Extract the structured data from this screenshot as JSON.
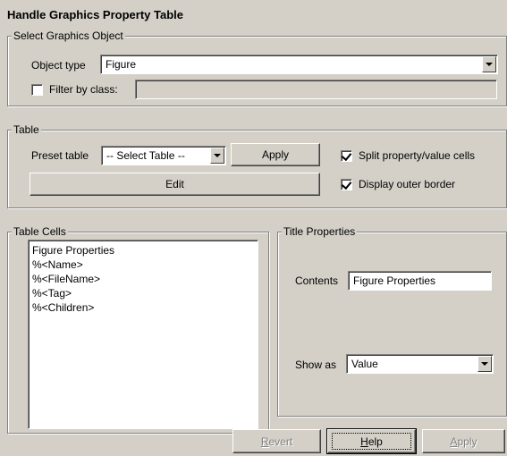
{
  "title": "Handle Graphics Property Table",
  "select_object": {
    "group_label": "Select Graphics Object",
    "object_type_label": "Object type",
    "object_type_value": "Figure",
    "filter_label": "Filter by class:",
    "filter_checked": false,
    "filter_value": ""
  },
  "table": {
    "group_label": "Table",
    "preset_label": "Preset table",
    "preset_value": "-- Select Table --",
    "apply_label": "Apply",
    "edit_label": "Edit",
    "split_label": "Split property/value cells",
    "split_checked": true,
    "border_label": "Display outer border",
    "border_checked": true
  },
  "table_cells": {
    "group_label": "Table Cells",
    "items": [
      "Figure Properties",
      "%<Name>",
      "%<FileName>",
      "%<Tag>",
      "%<Children>"
    ]
  },
  "title_properties": {
    "group_label": "Title Properties",
    "contents_label": "Contents",
    "contents_value": "Figure Properties",
    "show_as_label": "Show as",
    "show_as_value": "Value"
  },
  "footer": {
    "revert_first": "R",
    "revert_rest": "evert",
    "help_first": "H",
    "help_rest": "elp",
    "apply_first": "A",
    "apply_rest": "pply"
  },
  "icons": {
    "dropdown": "chevron-down-icon",
    "checkbox_mark": "check-icon"
  }
}
